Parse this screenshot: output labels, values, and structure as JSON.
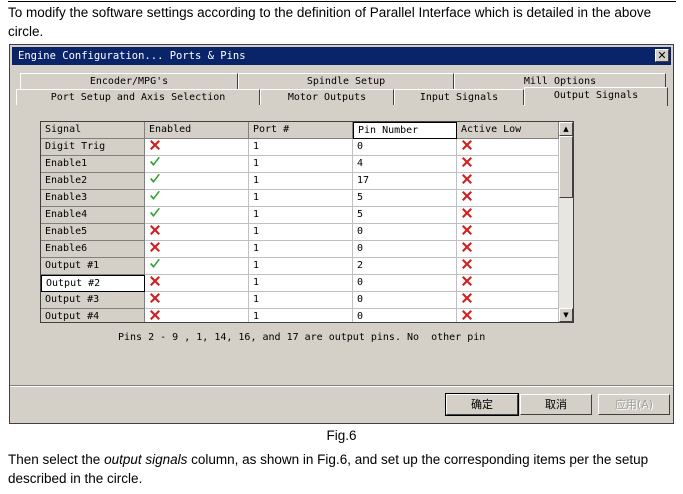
{
  "doc": {
    "top_text": "To modify the software settings according to the definition of Parallel Interface which is detailed in the above circle.",
    "caption": "Fig.6",
    "bottom_before": "Then select the ",
    "bottom_italic": "output signals",
    "bottom_after": " column, as shown in Fig.6, and set up the corresponding items per the setup described in the circle."
  },
  "window": {
    "title": "Engine Configuration... Ports & Pins",
    "close_glyph": "✕"
  },
  "tabs": {
    "back": [
      "Encoder/MPG's",
      "Spindle Setup",
      "Mill Options"
    ],
    "front": [
      "Port Setup and Axis Selection",
      "Motor Outputs",
      "Input Signals",
      "Output Signals"
    ],
    "active": "Output Signals"
  },
  "grid": {
    "columns": [
      "Signal",
      "Enabled",
      "Port #",
      "Pin Number",
      "Active Low"
    ],
    "rows": [
      {
        "signal": "Digit Trig",
        "enabled": false,
        "port": "1",
        "pin": "0",
        "active_low": false
      },
      {
        "signal": "Enable1",
        "enabled": true,
        "port": "1",
        "pin": "4",
        "active_low": false
      },
      {
        "signal": "Enable2",
        "enabled": true,
        "port": "1",
        "pin": "17",
        "active_low": false
      },
      {
        "signal": "Enable3",
        "enabled": true,
        "port": "1",
        "pin": "5",
        "active_low": false
      },
      {
        "signal": "Enable4",
        "enabled": true,
        "port": "1",
        "pin": "5",
        "active_low": false
      },
      {
        "signal": "Enable5",
        "enabled": false,
        "port": "1",
        "pin": "0",
        "active_low": false
      },
      {
        "signal": "Enable6",
        "enabled": false,
        "port": "1",
        "pin": "0",
        "active_low": false
      },
      {
        "signal": "Output #1",
        "enabled": true,
        "port": "1",
        "pin": "2",
        "active_low": false
      },
      {
        "signal": "Output #2",
        "enabled": false,
        "port": "1",
        "pin": "0",
        "active_low": false
      },
      {
        "signal": "Output #3",
        "enabled": false,
        "port": "1",
        "pin": "0",
        "active_low": false
      },
      {
        "signal": "Output #4",
        "enabled": false,
        "port": "1",
        "pin": "0",
        "active_low": false
      }
    ],
    "selected_signal": "Output #2",
    "icons": {
      "enabled": "green-check-icon",
      "disabled": "red-x-icon"
    },
    "colors": {
      "check": "#2ea02e",
      "x": "#d02020"
    }
  },
  "note": "Pins 2 - 9 , 1, 14, 16, and 17 are output pins. No  other pin",
  "buttons": {
    "ok": "确定",
    "cancel": "取消",
    "apply": "应用(A)"
  }
}
